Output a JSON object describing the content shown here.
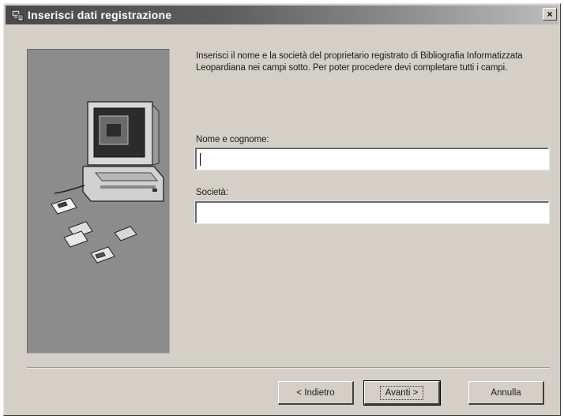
{
  "window": {
    "title": "Inserisci dati registrazione",
    "close_label": "×"
  },
  "main": {
    "description": "Inserisci il nome e la società del proprietario registrato di Bibliografia Informatizzata Leopardiana nei campi sotto. Per poter procedere devi completare tutti i campi.",
    "name_label": "Nome e cognome:",
    "name_value": "",
    "company_label": "Società:",
    "company_value": ""
  },
  "buttons": {
    "back": "< Indietro",
    "next": "Avanti >",
    "cancel": "Annulla"
  },
  "icons": {
    "title": "setup-icon",
    "illustration": "computer-illustration"
  }
}
